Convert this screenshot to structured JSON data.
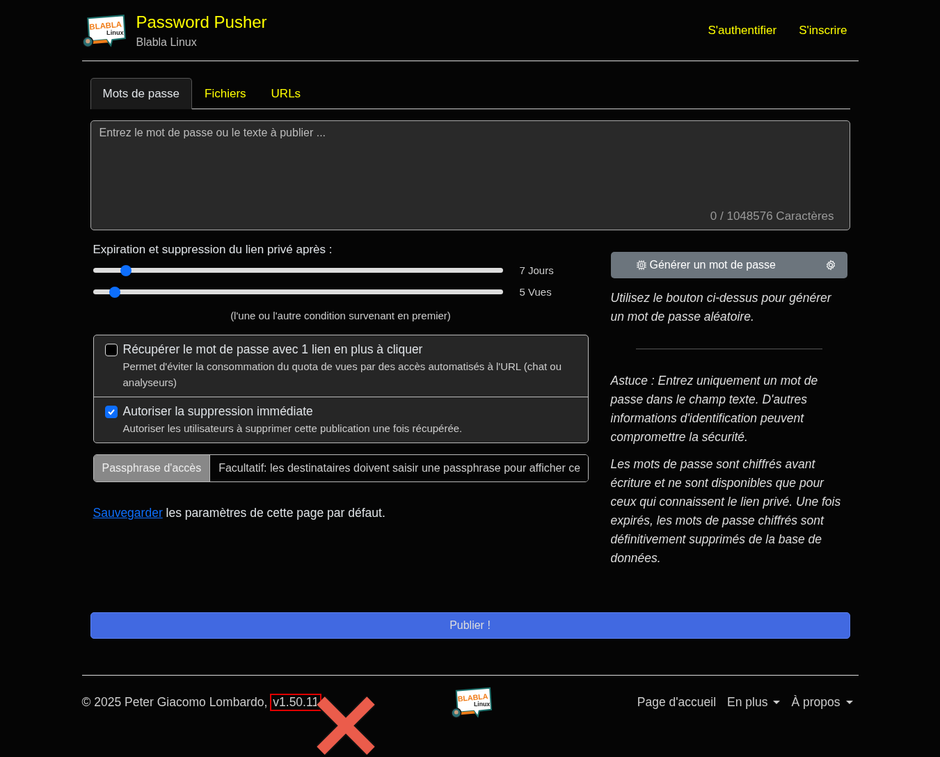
{
  "header": {
    "logo": {
      "word": "BLABLA",
      "sub": "Linux"
    },
    "title": "Password Pusher",
    "subtitle": "Blabla Linux",
    "nav": [
      "S'authentifier",
      "S'inscrire"
    ]
  },
  "tabs": [
    {
      "label": "Mots de passe",
      "selected": true
    },
    {
      "label": "Fichiers",
      "selected": false
    },
    {
      "label": "URLs",
      "selected": false
    }
  ],
  "payload": {
    "placeholder": "Entrez le mot de passe ou le texte à publier ...",
    "counter": "0 / 1048576 Caractères"
  },
  "expiration": {
    "label": "Expiration et suppression du lien privé après :",
    "sliders": [
      {
        "level": 0.08,
        "reading": "7 Jours"
      },
      {
        "level": 0.053,
        "reading": "5 Vues"
      }
    ],
    "note": "(l'une ou l'autre condition survenant en premier)"
  },
  "options": [
    {
      "label": "Récupérer le mot de passe avec 1 lien en plus à cliquer",
      "help": "Permet d'éviter la consommation du quota de vues par des accès automatisés à l'URL (chat ou analyseurs)",
      "checked": false
    },
    {
      "label": "Autoriser la suppression immédiate",
      "help": "Autoriser les utilisateurs à supprimer cette publication une fois récupérée.",
      "checked": true
    }
  ],
  "passphrase": {
    "label": "Passphrase d'accès",
    "placeholder": "Facultatif: les destinataires doivent saisir une passphrase pour afficher ce"
  },
  "save_note": {
    "link": "Sauvegarder",
    "text": " les paramètres de cette page par défaut."
  },
  "generator": {
    "button": "Générer un mot de passe",
    "hint": "Utilisez le bouton ci-dessus pour générer un mot de passe aléatoire."
  },
  "tips": [
    "Astuce : Entrez uniquement un mot de passe dans le champ texte. D'autres informations d'identification peuvent compromettre la sécurité.",
    "Les mots de passe sont chiffrés avant écriture et ne sont disponibles que pour ceux qui connaissent le lien privé. Une fois expirés, les mots de passe chiffrés sont définitivement supprimés de la base de données."
  ],
  "publish": "Publier !",
  "footer": {
    "copyright": "© 2025 Peter Giacomo Lombardo,",
    "version": "v1.50.11",
    "version_marked": true,
    "logo": {
      "word": "BLABLA",
      "sub": "Linux"
    },
    "links": [
      {
        "label": "Page d'accueil",
        "dropdown": false
      },
      {
        "label": "En plus",
        "dropdown": true
      },
      {
        "label": "À propos",
        "dropdown": true
      }
    ]
  }
}
